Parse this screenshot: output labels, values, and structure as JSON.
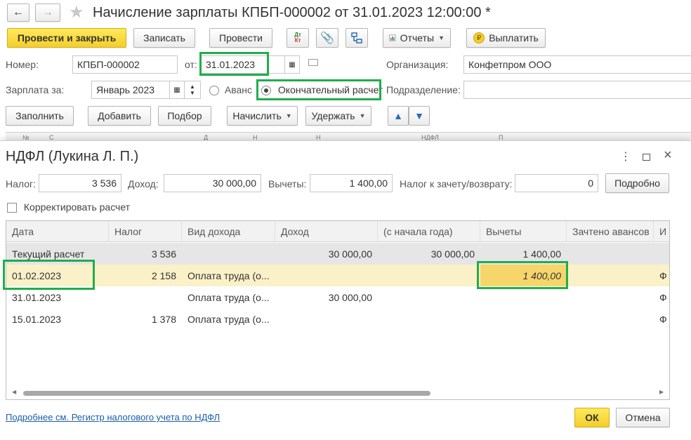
{
  "window": {
    "title": "Начисление зарплаты КПБП-000002 от 31.01.2023 12:00:00 *"
  },
  "toolbar": {
    "post_close": "Провести и закрыть",
    "save": "Записать",
    "post": "Провести",
    "dt_kt_top": "Дт",
    "dt_kt_bottom": "Кт",
    "reports": "Отчеты",
    "pay": "Выплатить"
  },
  "form": {
    "number_label": "Номер:",
    "number_value": "КПБП-000002",
    "date_label": "от:",
    "date_value": "31.01.2023",
    "org_label": "Организация:",
    "org_value": "Конфетпром ООО",
    "salary_for_label": "Зарплата за:",
    "salary_for_value": "Январь 2023",
    "advance_label": "Аванс",
    "final_label": "Окончательный расчет",
    "dept_label": "Подразделение:",
    "dept_value": ""
  },
  "actions": {
    "fill": "Заполнить",
    "add": "Добавить",
    "select": "Подбор",
    "accrue": "Начислить",
    "withhold": "Удержать"
  },
  "back_headers": [
    "№",
    "С",
    "Д",
    "Н",
    "Н",
    "НДФЛ",
    "П"
  ],
  "dialog": {
    "title": "НДФЛ (Лукина Л. П.)",
    "tax_label": "Налог:",
    "tax_value": "3 536",
    "income_label": "Доход:",
    "income_value": "30 000,00",
    "deductions_label": "Вычеты:",
    "deductions_value": "1 400,00",
    "offset_label": "Налог к зачету/возврату:",
    "offset_value": "0",
    "details_button": "Подробно",
    "adjust_label": "Корректировать расчет",
    "columns": [
      "Дата",
      "Налог",
      "Вид дохода",
      "Доход",
      "(с начала года)",
      "Вычеты",
      "Зачтено авансов",
      "И"
    ],
    "rows": [
      {
        "date": "Текущий расчет",
        "tax": "3 536",
        "kind": "",
        "income": "30 000,00",
        "ytd": "30 000,00",
        "deductions": "1 400,00",
        "offset": "",
        "extra": ""
      },
      {
        "date": "01.02.2023",
        "tax": "2 158",
        "kind": "Оплата труда (о...",
        "income": "",
        "ytd": "",
        "deductions": "1 400,00",
        "offset": "",
        "extra": "Ф"
      },
      {
        "date": "31.01.2023",
        "tax": "",
        "kind": "Оплата труда (о...",
        "income": "30 000,00",
        "ytd": "",
        "deductions": "",
        "offset": "",
        "extra": "Ф"
      },
      {
        "date": "15.01.2023",
        "tax": "1 378",
        "kind": "Оплата труда (о...",
        "income": "",
        "ytd": "",
        "deductions": "",
        "offset": "",
        "extra": "Ф"
      }
    ],
    "link": "Подробнее см. Регистр налогового учета по НДФЛ",
    "ok": "ОК",
    "cancel": "Отмена"
  },
  "colors": {
    "highlight_green": "#1fae4b",
    "selected_row": "#fbf1c8",
    "primary_yellow": "#f4cf2a"
  }
}
